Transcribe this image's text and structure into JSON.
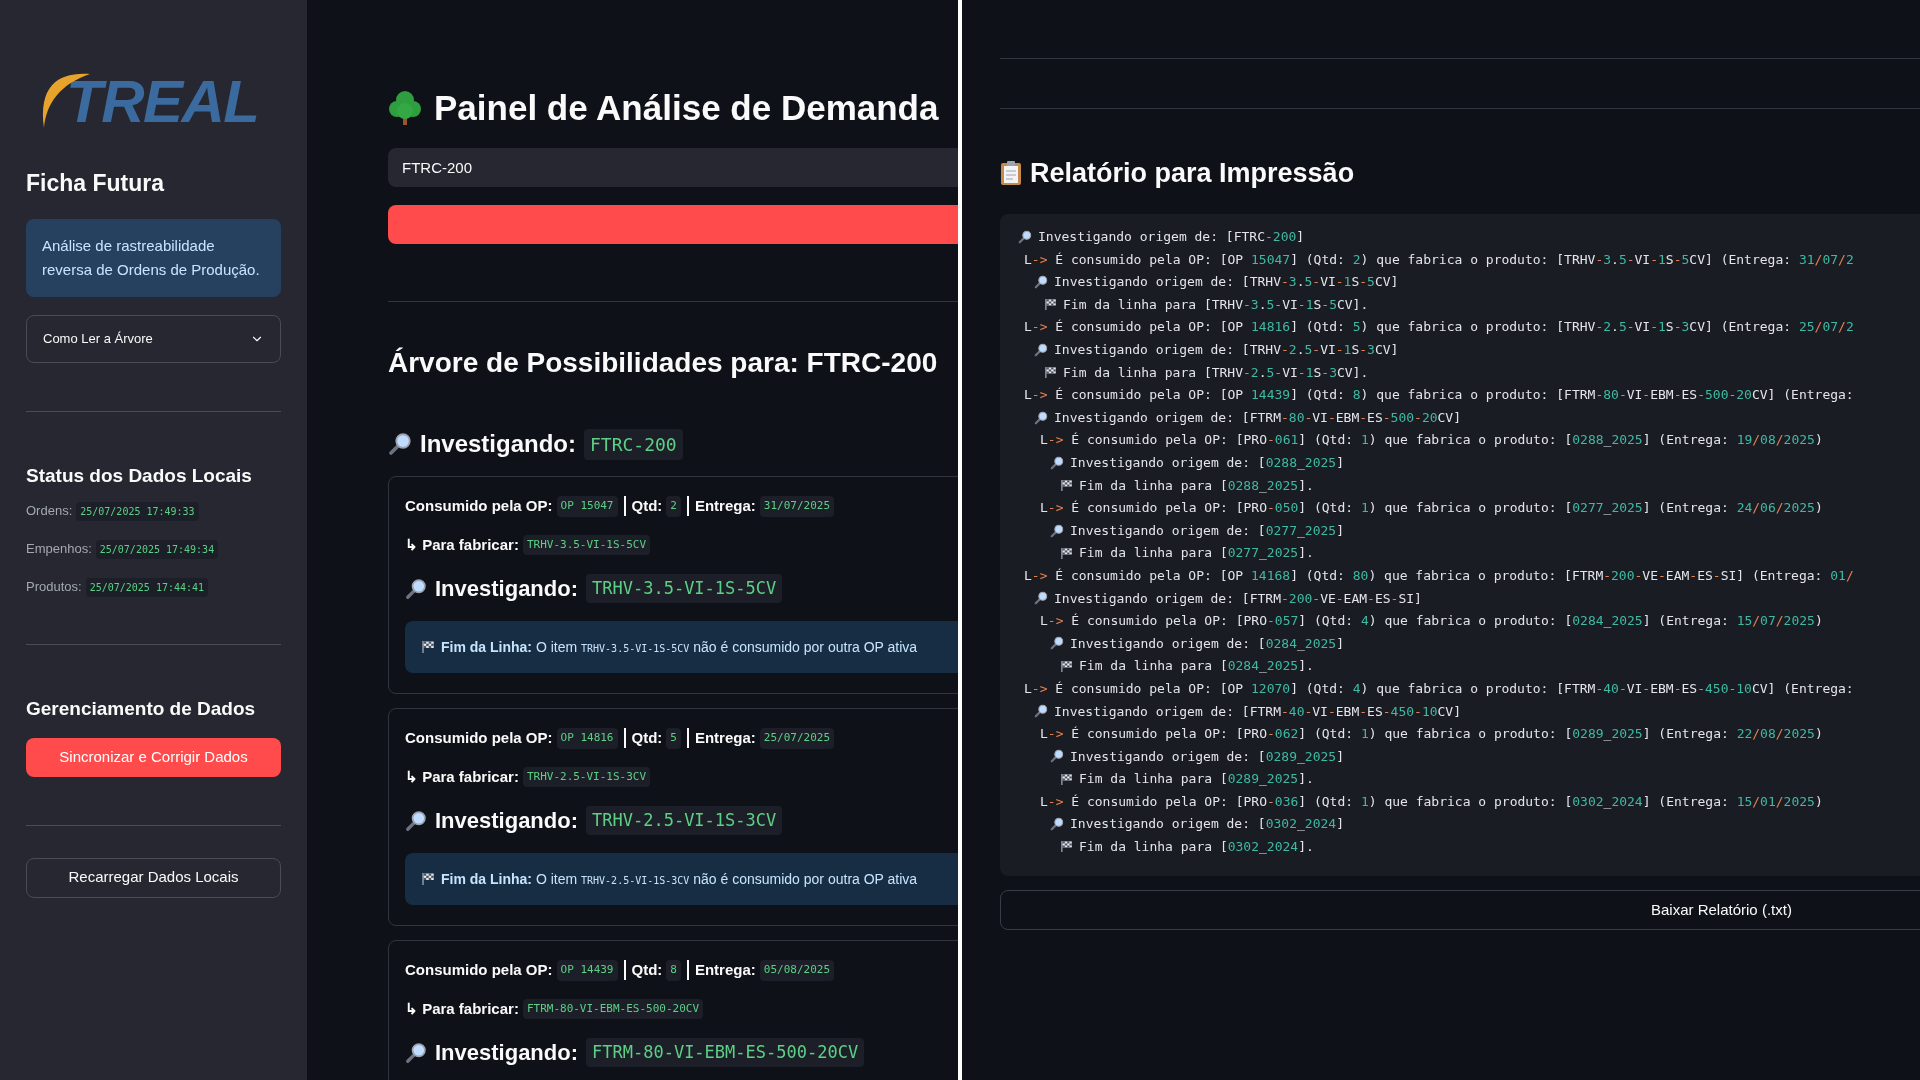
{
  "sidebar": {
    "logo": {
      "text": "TREAL"
    },
    "title": "Ficha Futura",
    "info": "Análise de rastreabilidade reversa de Ordens de Produção.",
    "expander": {
      "label": "Como Ler a Árvore",
      "expanded": false
    },
    "status_title": "Status dos Dados Locais",
    "status": [
      {
        "label": "Ordens:",
        "value": "25/07/2025 17:49:33"
      },
      {
        "label": "Empenhos:",
        "value": "25/07/2025 17:49:34"
      },
      {
        "label": "Produtos:",
        "value": "25/07/2025 17:44:41"
      }
    ],
    "manage_title": "Gerenciamento de Dados",
    "sync_button": "Sincronizar e Corrigir Dados",
    "reload_button": "Recarregar Dados Locais"
  },
  "main": {
    "title": "Painel de Análise de Demanda",
    "search": {
      "value": "FTRC-200"
    },
    "tree_title": "Árvore de Possibilidades para: FTRC-200",
    "root": {
      "label": "Investigando:",
      "code": "FTRC-200"
    },
    "cards": [
      {
        "op_label": "Consumido pela OP:",
        "op": "OP 15047",
        "qtd_label": "Qtd:",
        "qtd": "2",
        "date_label": "Entrega:",
        "date": "31/07/2025",
        "make_label": "↳ Para fabricar:",
        "make": "TRHV-3.5-VI-1S-5CV",
        "inv_label": "Investigando:",
        "inv": "TRHV-3.5-VI-1S-5CV",
        "end": {
          "label": "Fim da Linha:",
          "before": "O item",
          "code": "TRHV-3.5-VI-1S-5CV",
          "after": "não é consumido por outra OP ativa"
        }
      },
      {
        "op_label": "Consumido pela OP:",
        "op": "OP 14816",
        "qtd_label": "Qtd:",
        "qtd": "5",
        "date_label": "Entrega:",
        "date": "25/07/2025",
        "make_label": "↳ Para fabricar:",
        "make": "TRHV-2.5-VI-1S-3CV",
        "inv_label": "Investigando:",
        "inv": "TRHV-2.5-VI-1S-3CV",
        "end": {
          "label": "Fim da Linha:",
          "before": "O item",
          "code": "TRHV-2.5-VI-1S-3CV",
          "after": "não é consumido por outra OP ativa"
        }
      },
      {
        "op_label": "Consumido pela OP:",
        "op": "OP 14439",
        "qtd_label": "Qtd:",
        "qtd": "8",
        "date_label": "Entrega:",
        "date": "05/08/2025",
        "make_label": "↳ Para fabricar:",
        "make": "FTRM-80-VI-EBM-ES-500-20CV",
        "inv_label": "Investigando:",
        "inv": "FTRM-80-VI-EBM-ES-500-20CV"
      }
    ]
  },
  "report": {
    "title": "Relatório para Impressão",
    "lines": [
      {
        "kind": "investigate",
        "text": "Investigando origem de: [FTRC-200]",
        "children": [
          {
            "kind": "consumed",
            "text": "L-> É consumido pela OP: [OP 15047] (Qtd: 2) que fabrica o produto: [TRHV-3.5-VI-1S-5CV] (Entrega: 31/07/2",
            "children": [
              {
                "kind": "investigate",
                "text": "Investigando origem de: [TRHV-3.5-VI-1S-5CV]",
                "children": [
                  {
                    "kind": "end",
                    "text": "Fim da linha para [TRHV-3.5-VI-1S-5CV]."
                  }
                ]
              }
            ]
          },
          {
            "kind": "consumed",
            "text": "L-> É consumido pela OP: [OP 14816] (Qtd: 5) que fabrica o produto: [TRHV-2.5-VI-1S-3CV] (Entrega: 25/07/2",
            "children": [
              {
                "kind": "investigate",
                "text": "Investigando origem de: [TRHV-2.5-VI-1S-3CV]",
                "children": [
                  {
                    "kind": "end",
                    "text": "Fim da linha para [TRHV-2.5-VI-1S-3CV]."
                  }
                ]
              }
            ]
          },
          {
            "kind": "consumed",
            "text": "L-> É consumido pela OP: [OP 14439] (Qtd: 8) que fabrica o produto: [FTRM-80-VI-EBM-ES-500-20CV] (Entrega:",
            "children": [
              {
                "kind": "investigate",
                "text": "Investigando origem de: [FTRM-80-VI-EBM-ES-500-20CV]",
                "children": [
                  {
                    "kind": "consumed",
                    "text": "L-> É consumido pela OP: [PRO-061] (Qtd: 1) que fabrica o produto: [0288_2025] (Entrega: 19/08/2025)",
                    "children": [
                      {
                        "kind": "investigate",
                        "text": "Investigando origem de: [0288_2025]",
                        "children": [
                          {
                            "kind": "end",
                            "text": "Fim da linha para [0288_2025]."
                          }
                        ]
                      }
                    ]
                  },
                  {
                    "kind": "consumed",
                    "text": "L-> É consumido pela OP: [PRO-050] (Qtd: 1) que fabrica o produto: [0277_2025] (Entrega: 24/06/2025)",
                    "children": [
                      {
                        "kind": "investigate",
                        "text": "Investigando origem de: [0277_2025]",
                        "children": [
                          {
                            "kind": "end",
                            "text": "Fim da linha para [0277_2025]."
                          }
                        ]
                      }
                    ]
                  }
                ]
              }
            ]
          },
          {
            "kind": "consumed",
            "text": "L-> É consumido pela OP: [OP 14168] (Qtd: 80) que fabrica o produto: [FTRM-200-VE-EAM-ES-SI] (Entrega: 01/",
            "children": [
              {
                "kind": "investigate",
                "text": "Investigando origem de: [FTRM-200-VE-EAM-ES-SI]",
                "children": [
                  {
                    "kind": "consumed",
                    "text": "L-> É consumido pela OP: [PRO-057] (Qtd: 4) que fabrica o produto: [0284_2025] (Entrega: 15/07/2025)",
                    "children": [
                      {
                        "kind": "investigate",
                        "text": "Investigando origem de: [0284_2025]",
                        "children": [
                          {
                            "kind": "end",
                            "text": "Fim da linha para [0284_2025]."
                          }
                        ]
                      }
                    ]
                  }
                ]
              }
            ]
          },
          {
            "kind": "consumed",
            "text": "L-> É consumido pela OP: [OP 12070] (Qtd: 4) que fabrica o produto: [FTRM-40-VI-EBM-ES-450-10CV] (Entrega:",
            "children": [
              {
                "kind": "investigate",
                "text": "Investigando origem de: [FTRM-40-VI-EBM-ES-450-10CV]",
                "children": [
                  {
                    "kind": "consumed",
                    "text": "L-> É consumido pela OP: [PRO-062] (Qtd: 1) que fabrica o produto: [0289_2025] (Entrega: 22/08/2025)",
                    "children": [
                      {
                        "kind": "investigate",
                        "text": "Investigando origem de: [0289_2025]",
                        "children": [
                          {
                            "kind": "end",
                            "text": "Fim da linha para [0289_2025]."
                          }
                        ]
                      }
                    ]
                  },
                  {
                    "kind": "consumed",
                    "text": "L-> É consumido pela OP: [PRO-036] (Qtd: 1) que fabrica o produto: [0302_2024] (Entrega: 15/01/2025)",
                    "children": [
                      {
                        "kind": "investigate",
                        "text": "Investigando origem de: [0302_2024]",
                        "children": [
                          {
                            "kind": "end",
                            "text": "Fim da linha para [0302_2024]."
                          }
                        ]
                      }
                    ]
                  }
                ]
              }
            ]
          }
        ]
      }
    ],
    "download_button": "Baixar Relatório (.txt)"
  }
}
